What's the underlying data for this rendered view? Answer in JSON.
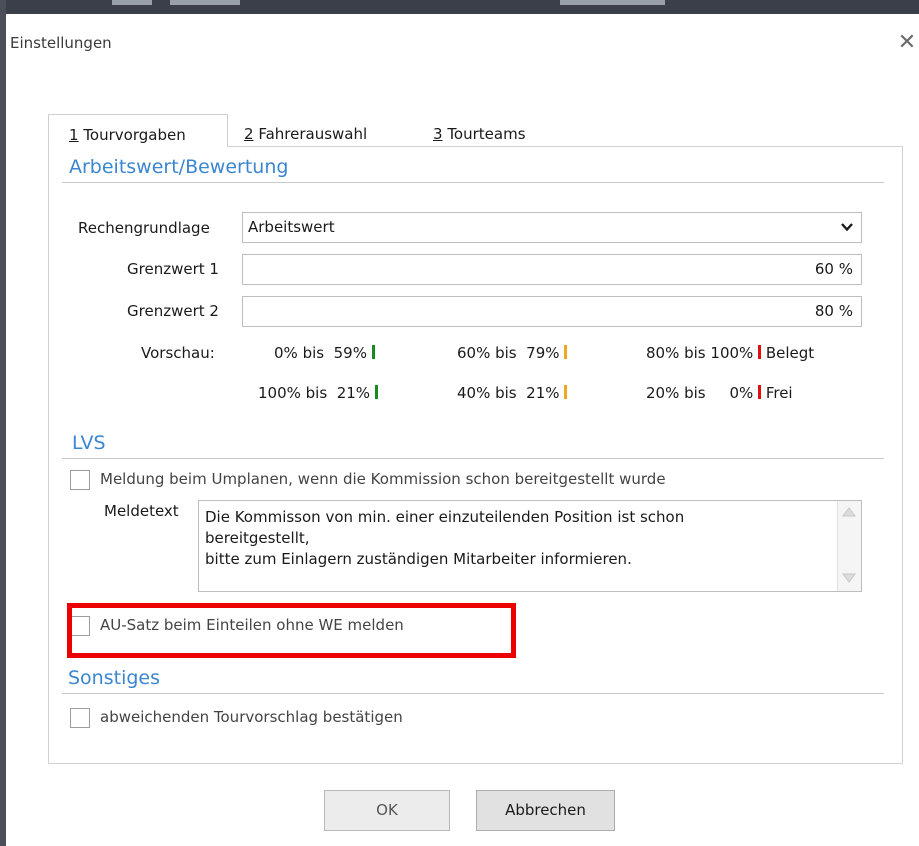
{
  "dialog": {
    "title": "Einstellungen",
    "close_glyph": "✕"
  },
  "tabs": [
    {
      "mnemonic": "1",
      "rest": " Tourvorgaben",
      "active": true
    },
    {
      "mnemonic": "2",
      "rest": " Fahrerauswahl",
      "active": false
    },
    {
      "mnemonic": "3",
      "rest": " Tourteams",
      "active": false
    }
  ],
  "arbeitswert": {
    "heading": "Arbeitswert/Bewertung",
    "rechengrundlage_label": "Rechengrundlage",
    "rechengrundlage_value": "Arbeitswert",
    "grenzwert1_label": "Grenzwert 1",
    "grenzwert1_value": "60 %",
    "grenzwert2_label": "Grenzwert 2",
    "grenzwert2_value": "80 %",
    "vorschau_label": "Vorschau:",
    "belegt": [
      {
        "from": "0% bis",
        "to": "59%",
        "color": "#1a8a1a"
      },
      {
        "from": "60% bis",
        "to": "79%",
        "color": "#f5a623"
      },
      {
        "from": "80% bis",
        "to": "100%",
        "color": "#e01010"
      }
    ],
    "belegt_label": "Belegt",
    "frei": [
      {
        "from": "100% bis",
        "to": "21%",
        "color": "#1a8a1a"
      },
      {
        "from": "40% bis",
        "to": "21%",
        "color": "#f5a623"
      },
      {
        "from": "20% bis",
        "to": "0%",
        "color": "#e01010"
      }
    ],
    "frei_label": "Frei"
  },
  "lvs": {
    "heading": "LVS",
    "meldung_checkbox_label": "Meldung beim Umplanen, wenn die Kommission schon bereitgestellt wurde",
    "meldung_checked": false,
    "meldetext_label": "Meldetext",
    "meldetext_line1": "Die Kommisson von min. einer einzuteilenden Position ist schon",
    "meldetext_line2": "bereitgestellt,",
    "meldetext_line3": "bitte zum Einlagern zuständigen Mitarbeiter informieren.",
    "au_satz_label": "AU-Satz beim Einteilen ohne WE melden",
    "au_satz_checked": false
  },
  "sonstiges": {
    "heading": "Sonstiges",
    "tourvorschlag_label": "abweichenden Tourvorschlag bestätigen",
    "tourvorschlag_checked": false
  },
  "buttons": {
    "ok": "OK",
    "cancel": "Abbrechen"
  },
  "colors": {
    "accent_heading": "#3a86d0",
    "highlight_box": "#ec0000"
  }
}
